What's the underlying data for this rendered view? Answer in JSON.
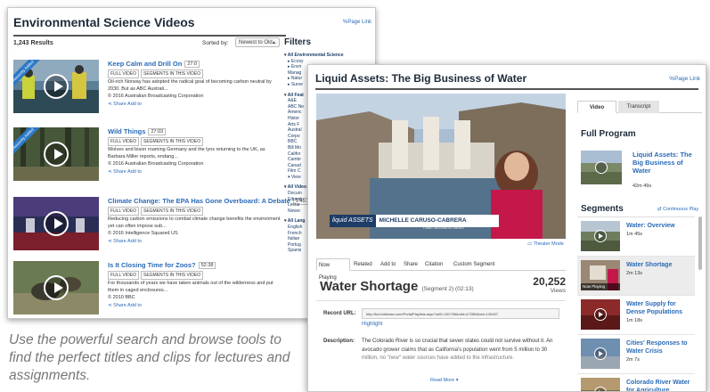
{
  "back_window": {
    "title": "Environmental Science Videos",
    "page_link": "Page Link",
    "result_count": "1,243 Results",
    "sort_label": "Sorted by:",
    "sort_value": "Newest to Old...",
    "results": [
      {
        "title": "Keep Calm and Drill On",
        "duration": "27:0",
        "tags": [
          "FULL VIDEO",
          "SEGMENTS IN THIS VIDEO"
        ],
        "description": "Oil-rich Norway has adopted the radical goal of becoming carbon neutral by 2030. But as ABC Australi...",
        "copyright": "© 2016 Australian Broadcasting Corporation",
        "actions": "Share  Add to",
        "ribbon": "Recently Added"
      },
      {
        "title": "Wild Things",
        "duration": "27:03",
        "tags": [
          "FULL VIDEO",
          "SEGMENTS IN THIS VIDEO"
        ],
        "description": "Wolves and bison roaming Germany and the lynx returning to the UK, as Barbara Miller reports, endang...",
        "copyright": "© 2016 Australian Broadcasting Corporation",
        "actions": "Share  Add to",
        "ribbon": "Recently Added"
      },
      {
        "title": "Climate Change: The EPA Has Gone Overboard: A Debate",
        "duration": "1:45:20",
        "tags": [
          "FULL VIDEO",
          "SEGMENTS IN THIS VIDEO"
        ],
        "description": "Reducing carbon emissions to combat climate change benefits the environment yet can often impose sub...",
        "copyright": "© 2016 Intelligence Squared US",
        "actions": "Share  Add to",
        "ribbon": ""
      },
      {
        "title": "Is It Closing Time for Zoos?",
        "duration": "52:38",
        "tags": [
          "FULL VIDEO",
          "SEGMENTS IN THIS VIDEO"
        ],
        "description": "For thousands of years we have taken animals out of the wilderness and put them in caged enclosures...",
        "copyright": "© 2010 BBC",
        "actions": "Share  Add to",
        "ribbon": ""
      }
    ],
    "filters": {
      "title": "Filters",
      "groups": [
        {
          "head": "▾ All Environmental Science",
          "items": [
            "▸ Ecosy",
            "▸ Envir",
            "Manag",
            "▸ Natur",
            "▸ Surve"
          ]
        },
        {
          "head": "▾ All Feat",
          "items": [
            "A&E",
            "ABC Ne",
            "Americ",
            "Histor",
            "Arts F",
            "Austral",
            "Corpo",
            "BBC",
            "Bill Mo",
            "Califor",
            "Cambr",
            "Canad",
            "Film C",
            "▾ View"
          ]
        },
        {
          "head": "▾ All Video",
          "items": [
            "Docum",
            "Educat",
            "Lectur",
            "Newsr"
          ]
        },
        {
          "head": "▾ All Lang",
          "items": [
            "English",
            "French",
            "Italian",
            "Portug",
            "Spanis"
          ]
        }
      ]
    }
  },
  "caption": "Use the powerful search and browse tools to find the perfect titles and clips for lectures and assignments.",
  "front_window": {
    "title": "Liquid Assets: The Big Business of Water",
    "page_link": "Page Link",
    "lower_third": {
      "show": "liquid ASSETS",
      "name": "MICHELLE CARUSO-CABRERA",
      "subtitle": "CNBC BUSINESS NEWS"
    },
    "theater_mode": "Theater Mode",
    "tabs": [
      "Now Playing",
      "Related",
      "Add to",
      "Share",
      "Citation",
      "Custom Segment"
    ],
    "episode_title": "Water Shortage",
    "episode_segment": "(Segment 2) (02:13)",
    "views_count": "20,252",
    "views_label": "Views",
    "record_url_label": "Record URL:",
    "record_url": "http://fod.infobase.com/PortalPlaylists.aspx?wID=102756&xtid=47289&loid=139437",
    "highlight": "Highlight",
    "description_label": "Description:",
    "description": "The Colorado River is so crucial that seven states could not survive without it. An avocado grower claims that as California's population went from 5 million to 30 million, no \"new\" water sources have added to the infrastructure.",
    "read_more": "Read More ▾",
    "right_panel": {
      "tabs": [
        "Video",
        "Transcript"
      ],
      "full_program_heading": "Full Program",
      "full_program_title": "Liquid Assets: The Big Business of Water",
      "full_program_duration": "42m 49s",
      "segments_heading": "Segments",
      "continuous_play": "Continuous Play",
      "now_playing_label": "Now Playing",
      "segments": [
        {
          "title": "Water: Overview",
          "duration": "1m 45s"
        },
        {
          "title": "Water Shortage",
          "duration": "2m 13s"
        },
        {
          "title": "Water Supply for Dense Populations",
          "duration": "1m 18s"
        },
        {
          "title": "Cities' Responses to Water Crisis",
          "duration": "2m 7s"
        },
        {
          "title": "Colorado River Water for Agriculture",
          "duration": ""
        }
      ]
    }
  }
}
